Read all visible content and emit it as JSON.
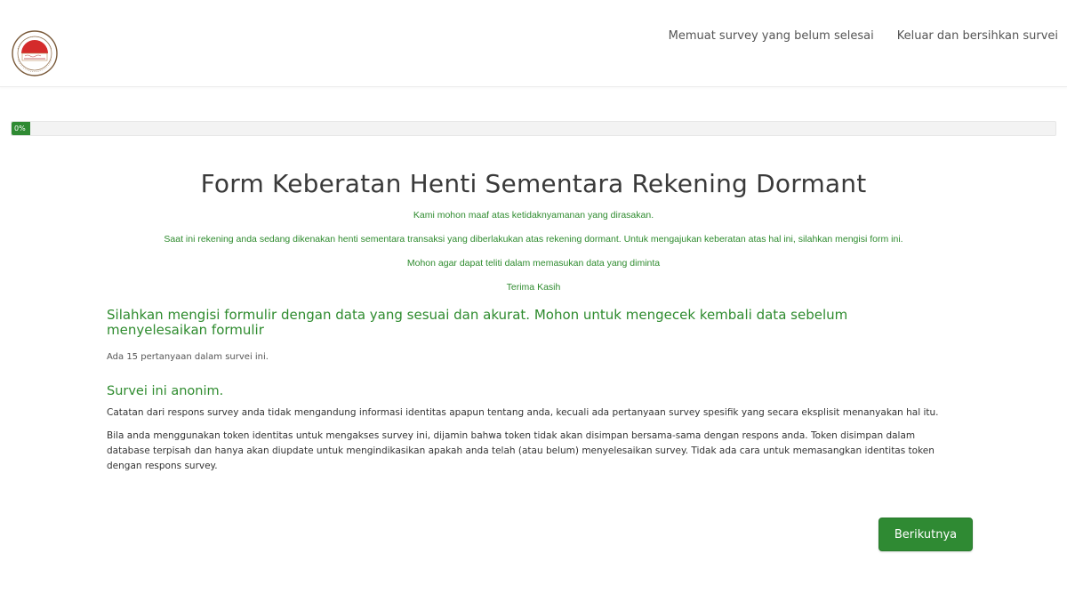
{
  "header": {
    "logo_icon": "institution-seal-logo",
    "nav": {
      "load_unfinished": "Memuat survey yang belum selesai",
      "exit_clear": "Keluar dan bersihkan survei"
    }
  },
  "progress": {
    "label": "0%",
    "value": 0,
    "color": "#2f8a33"
  },
  "survey": {
    "title": "Form Keberatan Henti Sementara Rekening Dormant",
    "description": [
      "Kami mohon maaf atas ketidaknyamanan yang dirasakan.",
      "Saat ini rekening anda sedang dikenakan henti sementara transaksi yang diberlakukan atas rekening dormant. Untuk mengajukan keberatan atas hal ini, silahkan mengisi form ini.",
      "Mohon agar dapat teliti dalam memasukan data yang diminta",
      "Terima Kasih"
    ],
    "welcome": "Silahkan mengisi formulir dengan data yang sesuai dan akurat. Mohon untuk mengecek kembali data sebelum menyelesaikan formulir",
    "question_count": "Ada 15 pertanyaan dalam survei ini.",
    "anonymous_title": "Survei ini anonim.",
    "anonymous_text": [
      "Catatan dari respons survey anda tidak mengandung informasi identitas apapun tentang anda, kecuali ada pertanyaan survey spesifik yang secara eksplisit menanyakan hal itu.",
      "Bila anda menggunakan token identitas untuk mengakses survey ini, dijamin bahwa token tidak akan disimpan bersama-sama dengan respons anda. Token disimpan dalam database terpisah dan hanya akan diupdate untuk mengindikasikan apakah anda telah (atau belum) menyelesaikan survey. Tidak ada cara untuk memasangkan identitas token dengan respons survey."
    ]
  },
  "actions": {
    "next": "Berikutnya"
  },
  "colors": {
    "accent": "#2f8a33",
    "text_green": "#2e8b2e"
  }
}
